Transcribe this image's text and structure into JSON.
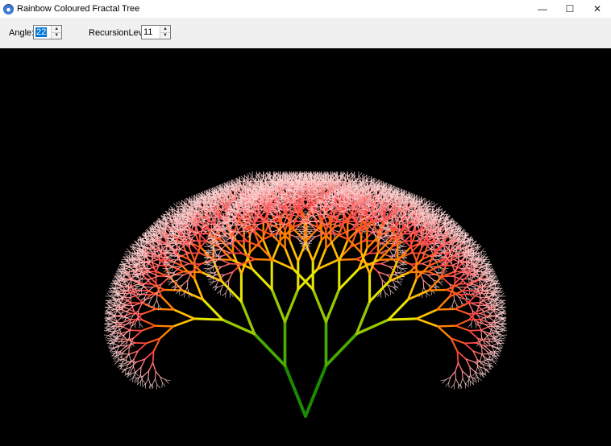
{
  "window": {
    "title": "Rainbow Coloured Fractal Tree",
    "icon": "app-globe-icon",
    "caption_buttons": {
      "minimize": "—",
      "maximize": "☐",
      "close": "✕"
    }
  },
  "controls": {
    "angle_label": "Angle:",
    "angle_value": "22",
    "recursion_label": "RecursionLevel:",
    "recursion_value": "11"
  },
  "canvas": {
    "background": "#000000",
    "trunk_color": "#1a8a00",
    "tip_color": "#ff6060"
  }
}
